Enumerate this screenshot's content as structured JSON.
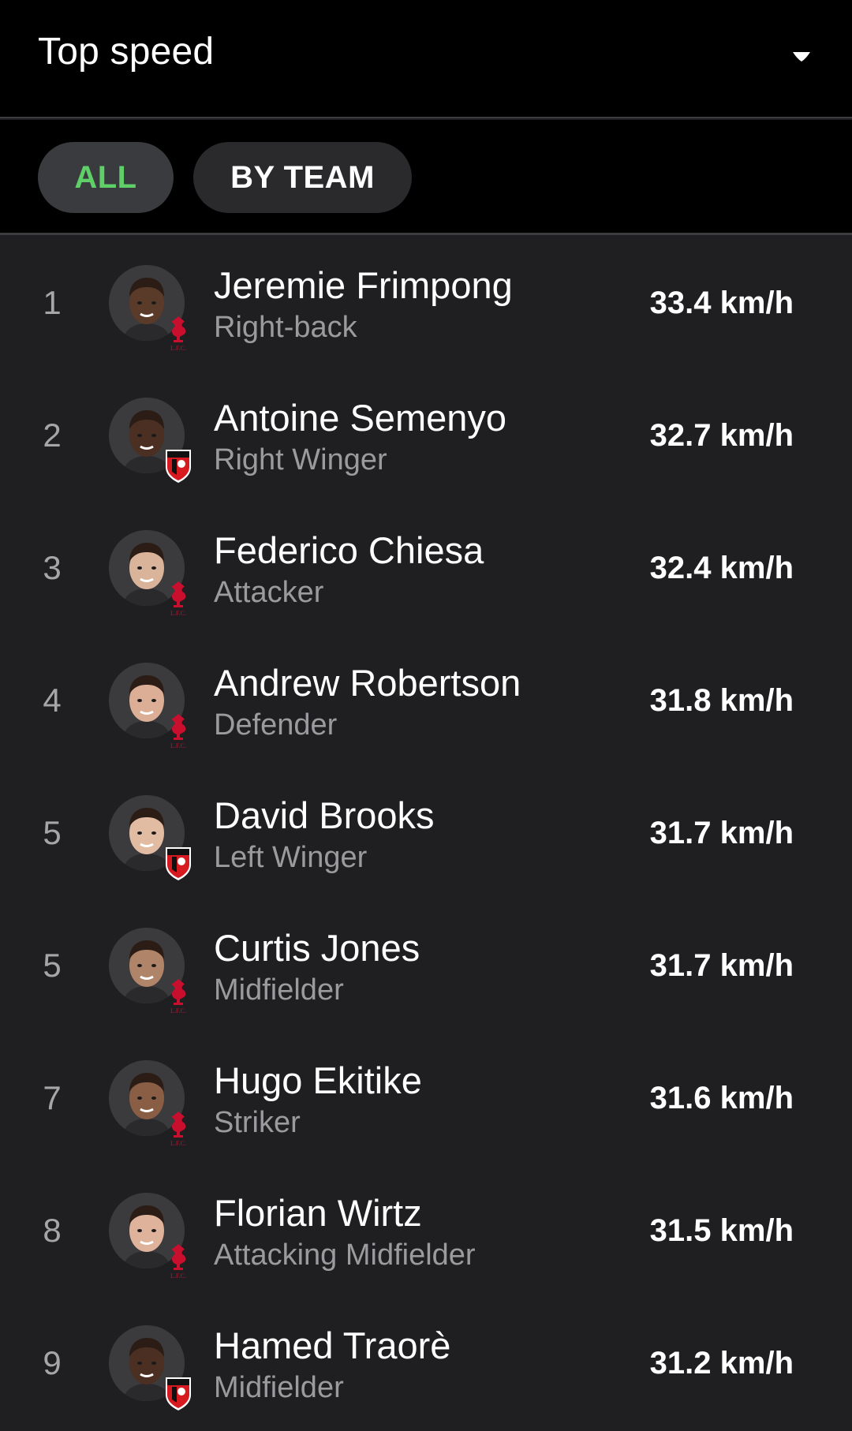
{
  "header": {
    "title": "Top speed",
    "dropdown_icon": "caret-down-icon"
  },
  "filters": {
    "all_label": "ALL",
    "by_team_label": "BY TEAM",
    "active": "ALL",
    "active_color": "#5fd068"
  },
  "players": [
    {
      "rank": "1",
      "name": "Jeremie Frimpong",
      "position": "Right-back",
      "speed": "33.4 km/h",
      "team": "liverpool",
      "skin": "#5a3b2a"
    },
    {
      "rank": "2",
      "name": "Antoine Semenyo",
      "position": "Right Winger",
      "speed": "32.7 km/h",
      "team": "bournemouth",
      "skin": "#4a2f22"
    },
    {
      "rank": "3",
      "name": "Federico Chiesa",
      "position": "Attacker",
      "speed": "32.4 km/h",
      "team": "liverpool",
      "skin": "#d9b39a"
    },
    {
      "rank": "4",
      "name": "Andrew Robertson",
      "position": "Defender",
      "speed": "31.8 km/h",
      "team": "liverpool",
      "skin": "#dcae96"
    },
    {
      "rank": "5",
      "name": "David Brooks",
      "position": "Left Winger",
      "speed": "31.7 km/h",
      "team": "bournemouth",
      "skin": "#e2bba3"
    },
    {
      "rank": "5",
      "name": "Curtis Jones",
      "position": "Midfielder",
      "speed": "31.7 km/h",
      "team": "liverpool",
      "skin": "#b08468"
    },
    {
      "rank": "7",
      "name": "Hugo Ekitike",
      "position": "Striker",
      "speed": "31.6 km/h",
      "team": "liverpool",
      "skin": "#8a5e45"
    },
    {
      "rank": "8",
      "name": "Florian Wirtz",
      "position": "Attacking Midfielder",
      "speed": "31.5 km/h",
      "team": "liverpool",
      "skin": "#dfb39b"
    },
    {
      "rank": "9",
      "name": "Hamed Traorè",
      "position": "Midfielder",
      "speed": "31.2 km/h",
      "team": "bournemouth",
      "skin": "#4b2f22"
    }
  ]
}
